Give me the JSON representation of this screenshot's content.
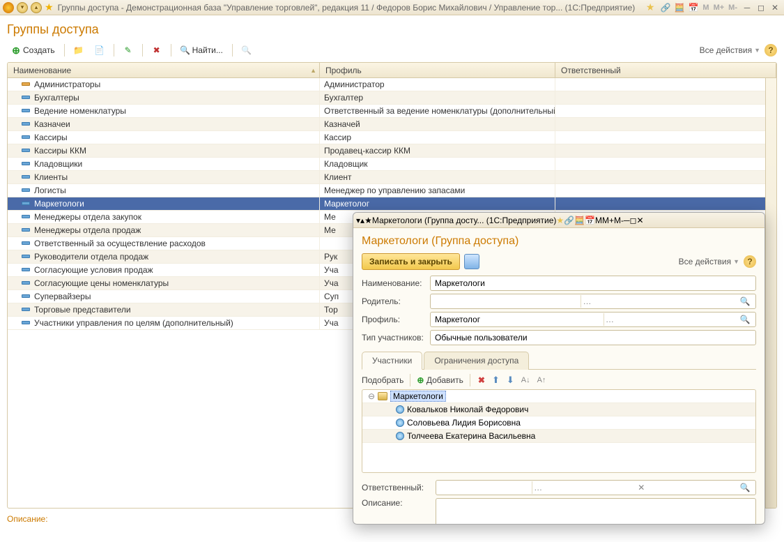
{
  "main_window": {
    "title": "Группы доступа - Демонстрационная база \"Управление торговлей\", редакция 11 / Федоров Борис Михайлович / Управление тор...   (1С:Предприятие)",
    "m_buttons": [
      "M",
      "M+",
      "M-"
    ]
  },
  "page": {
    "title": "Группы доступа",
    "toolbar": {
      "create": "Создать",
      "find": "Найти..."
    },
    "all_actions": "Все действия",
    "description_label": "Описание:",
    "columns": {
      "c1": "Наименование",
      "c2": "Профиль",
      "c3": "Ответственный"
    },
    "rows": [
      {
        "name": "Администраторы",
        "profile": "Администратор",
        "admin": true
      },
      {
        "name": "Бухгалтеры",
        "profile": "Бухгалтер"
      },
      {
        "name": "Ведение номенклатуры",
        "profile": "Ответственный за ведение номенклатуры (дополнительный)"
      },
      {
        "name": "Казначеи",
        "profile": "Казначей"
      },
      {
        "name": "Кассиры",
        "profile": "Кассир"
      },
      {
        "name": "Кассиры ККМ",
        "profile": "Продавец-кассир ККМ"
      },
      {
        "name": "Кладовщики",
        "profile": "Кладовщик"
      },
      {
        "name": "Клиенты",
        "profile": "Клиент"
      },
      {
        "name": "Логисты",
        "profile": "Менеджер по управлению запасами"
      },
      {
        "name": "Маркетологи",
        "profile": "Маркетолог",
        "selected": true
      },
      {
        "name": "Менеджеры отдела закупок",
        "profile": "Ме"
      },
      {
        "name": "Менеджеры отдела продаж",
        "profile": "Ме"
      },
      {
        "name": "Ответственный за осуществление расходов",
        "profile": ""
      },
      {
        "name": "Руководители отдела продаж",
        "profile": "Рук"
      },
      {
        "name": "Согласующие условия продаж",
        "profile": "Уча"
      },
      {
        "name": "Согласующие цены номенклатуры",
        "profile": "Уча"
      },
      {
        "name": "Супервайзеры",
        "profile": "Суп"
      },
      {
        "name": "Торговые представители",
        "profile": "Тор"
      },
      {
        "name": "Участники управления по целям (дополнительный)",
        "profile": "Уча"
      }
    ]
  },
  "dialog": {
    "titlebar": "Маркетологи (Группа досту...   (1С:Предприятие)",
    "title": "Маркетологи (Группа доступа)",
    "save_close": "Записать и закрыть",
    "all_actions": "Все действия",
    "labels": {
      "name": "Наименование:",
      "parent": "Родитель:",
      "profile": "Профиль:",
      "member_type": "Тип участников:",
      "responsible": "Ответственный:",
      "description": "Описание:"
    },
    "values": {
      "name": "Маркетологи",
      "parent": "",
      "profile": "Маркетолог",
      "member_type": "Обычные пользователи",
      "responsible": "",
      "description": ""
    },
    "tabs": {
      "t1": "Участники",
      "t2": "Ограничения доступа"
    },
    "inner_toolbar": {
      "pick": "Подобрать",
      "add": "Добавить"
    },
    "tree": {
      "root": "Маркетологи",
      "children": [
        "Ковальков Николай Федорович",
        "Соловьева Лидия Борисовна",
        "Толчеева Екатерина Васильевна"
      ]
    },
    "m_buttons": [
      "M",
      "M+",
      "M-"
    ]
  }
}
